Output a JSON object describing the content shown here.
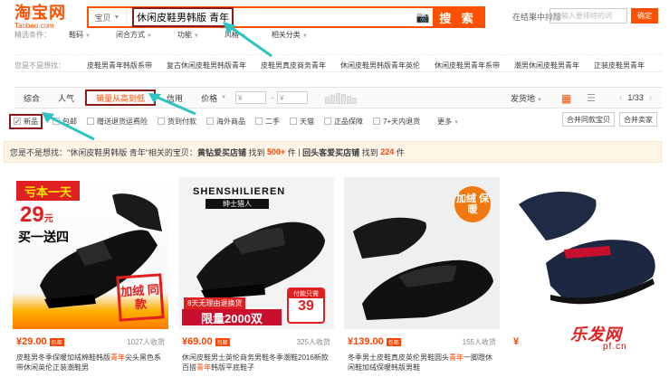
{
  "header": {
    "logo_main": "淘宝网",
    "logo_sub": "Taobao.com",
    "search_category": "宝贝",
    "search_query_part1": "休闲皮鞋男韩版",
    "search_query_part2": "青年",
    "search_button": "搜 索",
    "in_result_label": "在结果中排除",
    "exclude_placeholder": "请输入要排除的词",
    "confirm_button": "确定"
  },
  "filters": {
    "label": "精选条件：",
    "items": [
      "鞋码",
      "闭合方式",
      "功能",
      "风格",
      "相关分类"
    ]
  },
  "related": {
    "label": "您是不是想找：",
    "tags": [
      "皮鞋男青年韩版系带",
      "复古休闲皮鞋男韩版青年",
      "皮鞋男真皮商务青年",
      "休闲皮鞋男韩版青年英伦",
      "休闲皮鞋男青年系带",
      "潮男休闲皮鞋男青年",
      "正装皮鞋男青年"
    ]
  },
  "sort": {
    "items": [
      "综合",
      "人气",
      "销量从高到低",
      "信用",
      "价格"
    ],
    "price_placeholder": "¥",
    "ship_from": "发货地",
    "page_current": "1/33"
  },
  "checks": {
    "items": [
      "新品",
      "包邮",
      "赠送退货运费险",
      "货到付款",
      "海外商品",
      "二手",
      "天猫",
      "正品保障",
      "7+天内退货"
    ],
    "more": "更多",
    "merge_same": "合并同款宝贝",
    "merge_seller": "合并卖家"
  },
  "notice": {
    "prefix": "您是不是想找：",
    "query": "\"休闲皮鞋男韩版 青年\"",
    "mid": "相关的宝贝：",
    "store1": "黄钻爱买店铺",
    "found1": "找到",
    "count1": "500+",
    "unit1": "件",
    "store2": "回头客爱买店铺",
    "found2": "找到",
    "count2": "224",
    "unit2": "件"
  },
  "products": [
    {
      "price": "¥29.00",
      "badge": "包邮",
      "sold": "1027人收货",
      "title_a": "皮鞋男冬季保暖加绒棉鞋韩版",
      "title_hi1": "青年",
      "title_b": "尖头黑色系带休闲英伦正装潮鞋男",
      "promo_banner": "亏本一天",
      "promo_price": "29",
      "promo_unit": "元",
      "promo_buy": "买一送四",
      "promo_thick": "加绒 同款"
    },
    {
      "price": "¥69.00",
      "badge": "包邮",
      "sold": "325人收货",
      "title_a": "休闲皮鞋男士英伦商务男鞋冬季潮鞋2016新款百搭",
      "title_hi1": "青年",
      "title_b": "韩版平底鞋子",
      "promo_brand": "SHENSHILIEREN",
      "promo_brand2": "绅士猎人",
      "promo_ribbon": "8天无理由退换货",
      "promo_limit": "限量2000双",
      "promo_pay_label": "付款只需",
      "promo_pay_value": "39"
    },
    {
      "price": "¥139.00",
      "badge": "包邮",
      "sold": "155人收货",
      "title_a": "冬季男士皮鞋真皮英伦男鞋圆头",
      "title_hi1": "青年",
      "title_b": "一脚蹬休闲鞋加绒保暖韩版男鞋",
      "promo_tag": "加绒 保暖"
    },
    {
      "price": "¥",
      "badge": "",
      "sold": "",
      "title_a": "",
      "title_hi1": "",
      "title_b": ""
    }
  ],
  "watermark": {
    "text": "乐发网",
    "sub": "pf.cn"
  },
  "colors": {
    "accent": "#ff5000",
    "price": "#ff4400",
    "highlight_box": "#8b1a1a",
    "arrow": "#2ec4c4",
    "notice_bg": "#fef5e7"
  }
}
